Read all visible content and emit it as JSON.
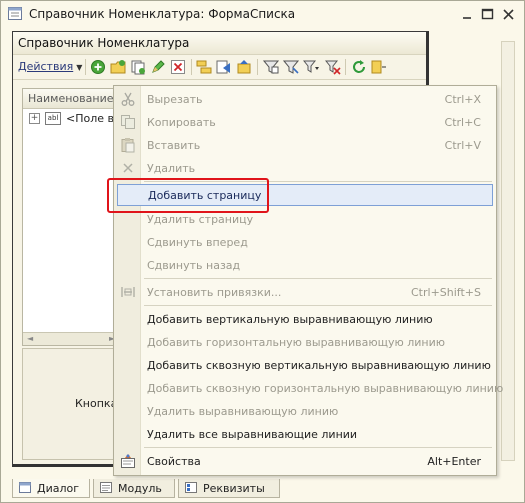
{
  "window": {
    "title": "Справочник Номенклатура: ФормаСписка"
  },
  "form": {
    "title": "Справочник Номенклатура",
    "actions_label": "Действия"
  },
  "grid": {
    "column_header": "Наименование",
    "row_text": "<Поле в..."
  },
  "lower_panel": {
    "button_text": "Кнопка"
  },
  "context_menu": {
    "items": [
      {
        "label": "Вырезать",
        "shortcut": "Ctrl+X",
        "enabled": false,
        "icon": "scissors-icon"
      },
      {
        "label": "Копировать",
        "shortcut": "Ctrl+C",
        "enabled": false,
        "icon": "copy-icon"
      },
      {
        "label": "Вставить",
        "shortcut": "Ctrl+V",
        "enabled": false,
        "icon": "paste-icon"
      },
      {
        "label": "Удалить",
        "shortcut": "",
        "enabled": false,
        "icon": "delete-x-icon"
      },
      {
        "label": "Добавить страницу",
        "shortcut": "",
        "enabled": true,
        "highlighted": true
      },
      {
        "label": "Удалить страницу",
        "shortcut": "",
        "enabled": false
      },
      {
        "label": "Сдвинуть вперед",
        "shortcut": "",
        "enabled": false
      },
      {
        "label": "Сдвинуть назад",
        "shortcut": "",
        "enabled": false
      },
      {
        "label": "Установить привязки...",
        "shortcut": "Ctrl+Shift+S",
        "enabled": false,
        "icon": "bindings-icon"
      },
      {
        "label": "Добавить вертикальную выравнивающую линию",
        "shortcut": "",
        "enabled": true
      },
      {
        "label": "Добавить горизонтальную выравнивающую линию",
        "shortcut": "",
        "enabled": false
      },
      {
        "label": "Добавить сквозную вертикальную выравнивающую линию",
        "shortcut": "",
        "enabled": true
      },
      {
        "label": "Добавить сквозную горизонтальную выравнивающую линию",
        "shortcut": "",
        "enabled": false
      },
      {
        "label": "Удалить выравнивающую линию",
        "shortcut": "",
        "enabled": false
      },
      {
        "label": "Удалить все выравнивающие линии",
        "shortcut": "",
        "enabled": true
      },
      {
        "label": "Свойства",
        "shortcut": "Alt+Enter",
        "enabled": true,
        "icon": "properties-icon"
      }
    ]
  },
  "tabs": [
    {
      "label": "Диалог",
      "active": true
    },
    {
      "label": "Модуль",
      "active": false
    },
    {
      "label": "Реквизиты",
      "active": false
    }
  ],
  "colors": {
    "highlight_border": "#7ea0d6",
    "annotation_red": "#e0141a",
    "disabled_text": "#9c9a8e"
  }
}
